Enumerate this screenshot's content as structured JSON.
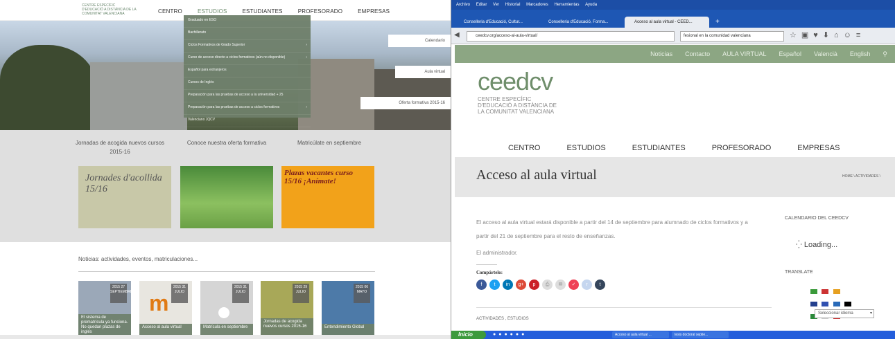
{
  "left": {
    "logo_text": "CENTRE ESPECÍFIC D'EDUCACIÓ A DISTÀNCIA DE LA COMUNITAT VALENCIANA",
    "nav": [
      "CENTRO",
      "ESTUDIOS",
      "ESTUDIANTES",
      "PROFESORADO",
      "EMPRESAS"
    ],
    "dropdown": [
      "Graduado en ESO",
      "Bachillerato",
      "Ciclos Formativos de Grado Superior",
      "Curso de acceso directo a ciclos formativos (aún no disponible)",
      "Español para extranjeros",
      "Cursos de Inglés",
      "Preparación para las pruebas de acceso a la universidad + 25",
      "Preparación para las pruebas de acceso a ciclos formativos",
      "Valenciano JQCV"
    ],
    "hero_tags": [
      "Calendario",
      "Aula virtual",
      "Oferta formativa 2015-16"
    ],
    "promos": [
      {
        "title": "Jornadas de acogida nuevos cursos 2015-16",
        "img_text": "Jornades d'acollida 15/16"
      },
      {
        "title": "Conoce nuestra oferta formativa",
        "img_text": ""
      },
      {
        "title": "Matricúlate en septiembre",
        "img_text": "Plazas vacantes curso 15/16 ¡Anímate!"
      }
    ],
    "news_heading": "Noticias: actividades, eventos, matriculaciones...",
    "cards": [
      {
        "date": "2015 27 SEPTIEMBRE",
        "caption": "El sistema de prematrícula ya funciona. No quedan plazas de inglés"
      },
      {
        "date": "2015 31 JULIO",
        "caption": "Acceso al aula virtual"
      },
      {
        "date": "2015 31 JULIO",
        "caption": "Matrícula en septiembre"
      },
      {
        "date": "2015 29 JULIO",
        "caption": "Jornadas de acogida nuevos cursos 2015-16"
      },
      {
        "date": "2015 06 MAYO",
        "caption": "Entendimiento Global"
      }
    ]
  },
  "browser": {
    "menu": [
      "Archivo",
      "Editar",
      "Ver",
      "Historial",
      "Marcadores",
      "Herramientas",
      "Ayuda"
    ],
    "tabs": [
      "Conselleria d'Educació, Cultur...",
      "Conselleria d'Educació, Forma...",
      "Acceso al aula virtual - CEED..."
    ],
    "url": "ceedcv.org/acceso-al-aula-virtual/",
    "search": "fesional en la comunidad valenciana",
    "taskbar_start": "Inicio",
    "taskbar_items": [
      "Acceso al aula virtual ...",
      "tesis doctoral septie..."
    ]
  },
  "site": {
    "topbar": [
      "Noticias",
      "Contacto",
      "AULA VIRTUAL",
      "Español",
      "Valencià",
      "English"
    ],
    "logo_big": "ceedcv",
    "logo_small": "CENTRE ESPECÍFIC D'EDUCACIÓ A DISTÀNCIA DE LA COMUNITAT VALENCIANA",
    "nav": [
      "CENTRO",
      "ESTUDIOS",
      "ESTUDIANTES",
      "PROFESORADO",
      "EMPRESAS"
    ],
    "page_title": "Acceso al aula virtual",
    "breadcrumb": "HOME \\ ACTIVIDADES \\",
    "content_p1": "El acceso al aula virtual estará disponible a partir del 14 de septiembre para alumnado de ciclos formativos y a partir del 21 de septiembre para el resto de enseñanzas.",
    "content_p2": "El administrador.",
    "share_heading": "Compártelo:",
    "categories": "ACTIVIDADES , ESTUDIOS",
    "sidebar_calendar": "CALENDARIO DEL CEEDCV",
    "loading": "Loading...",
    "translate": "TRANSLATE",
    "select_language": "Seleccionar idioma"
  },
  "colors": {
    "accent": "#8ca683",
    "dropdown": "#6e7f6a",
    "promo_bg": "#dfdfdf",
    "browser_blue": "#1e57b4"
  }
}
